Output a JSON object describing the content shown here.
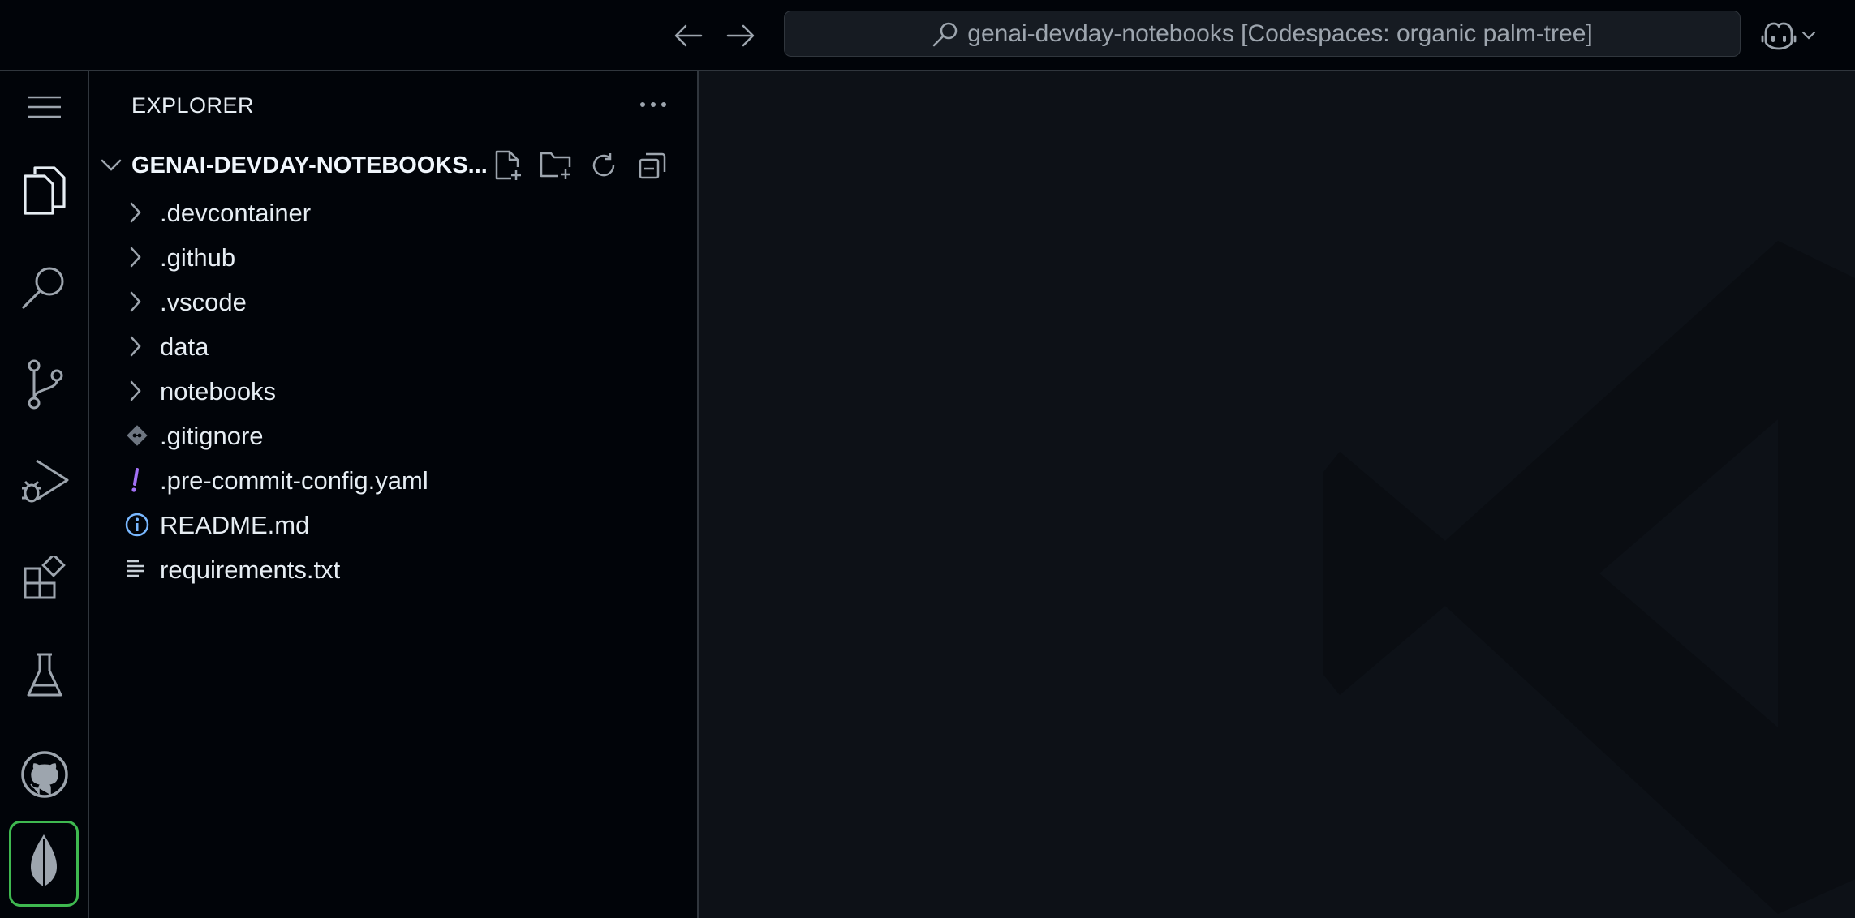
{
  "titlebar": {
    "back_icon": "arrow-left-icon",
    "forward_icon": "arrow-right-icon",
    "command_center": "genai-devday-notebooks [Codespaces: organic palm-tree]",
    "copilot_icon": "copilot-icon"
  },
  "activitybar": {
    "items": [
      {
        "id": "menu",
        "icon": "hamburger-menu-icon"
      },
      {
        "id": "explorer",
        "icon": "files-icon",
        "active": true
      },
      {
        "id": "search",
        "icon": "search-icon"
      },
      {
        "id": "source-control",
        "icon": "source-control-icon"
      },
      {
        "id": "run-debug",
        "icon": "run-debug-icon"
      },
      {
        "id": "extensions",
        "icon": "extensions-icon"
      },
      {
        "id": "testing",
        "icon": "beaker-icon"
      },
      {
        "id": "github",
        "icon": "github-icon"
      },
      {
        "id": "mongodb",
        "icon": "mongodb-leaf-icon",
        "highlight_color": "#3fb950"
      }
    ]
  },
  "explorer": {
    "title": "EXPLORER",
    "section_title": "GENAI-DEVDAY-NOTEBOOKS...",
    "actions": [
      "new-file-icon",
      "new-folder-icon",
      "refresh-icon",
      "collapse-all-icon"
    ],
    "items": [
      {
        "name": ".devcontainer",
        "type": "folder"
      },
      {
        "name": ".github",
        "type": "folder"
      },
      {
        "name": ".vscode",
        "type": "folder"
      },
      {
        "name": "data",
        "type": "folder"
      },
      {
        "name": "notebooks",
        "type": "folder"
      },
      {
        "name": ".gitignore",
        "type": "file",
        "icon": "git-icon"
      },
      {
        "name": ".pre-commit-config.yaml",
        "type": "file",
        "icon": "yaml-exclamation-icon"
      },
      {
        "name": "README.md",
        "type": "file",
        "icon": "info-icon"
      },
      {
        "name": "requirements.txt",
        "type": "file",
        "icon": "text-lines-icon"
      }
    ]
  },
  "colors": {
    "background": "#0d1117",
    "sidebar": "#010409",
    "accent_green": "#3fb950",
    "yaml_icon": "#a371f7",
    "info_icon": "#79b8ff"
  }
}
